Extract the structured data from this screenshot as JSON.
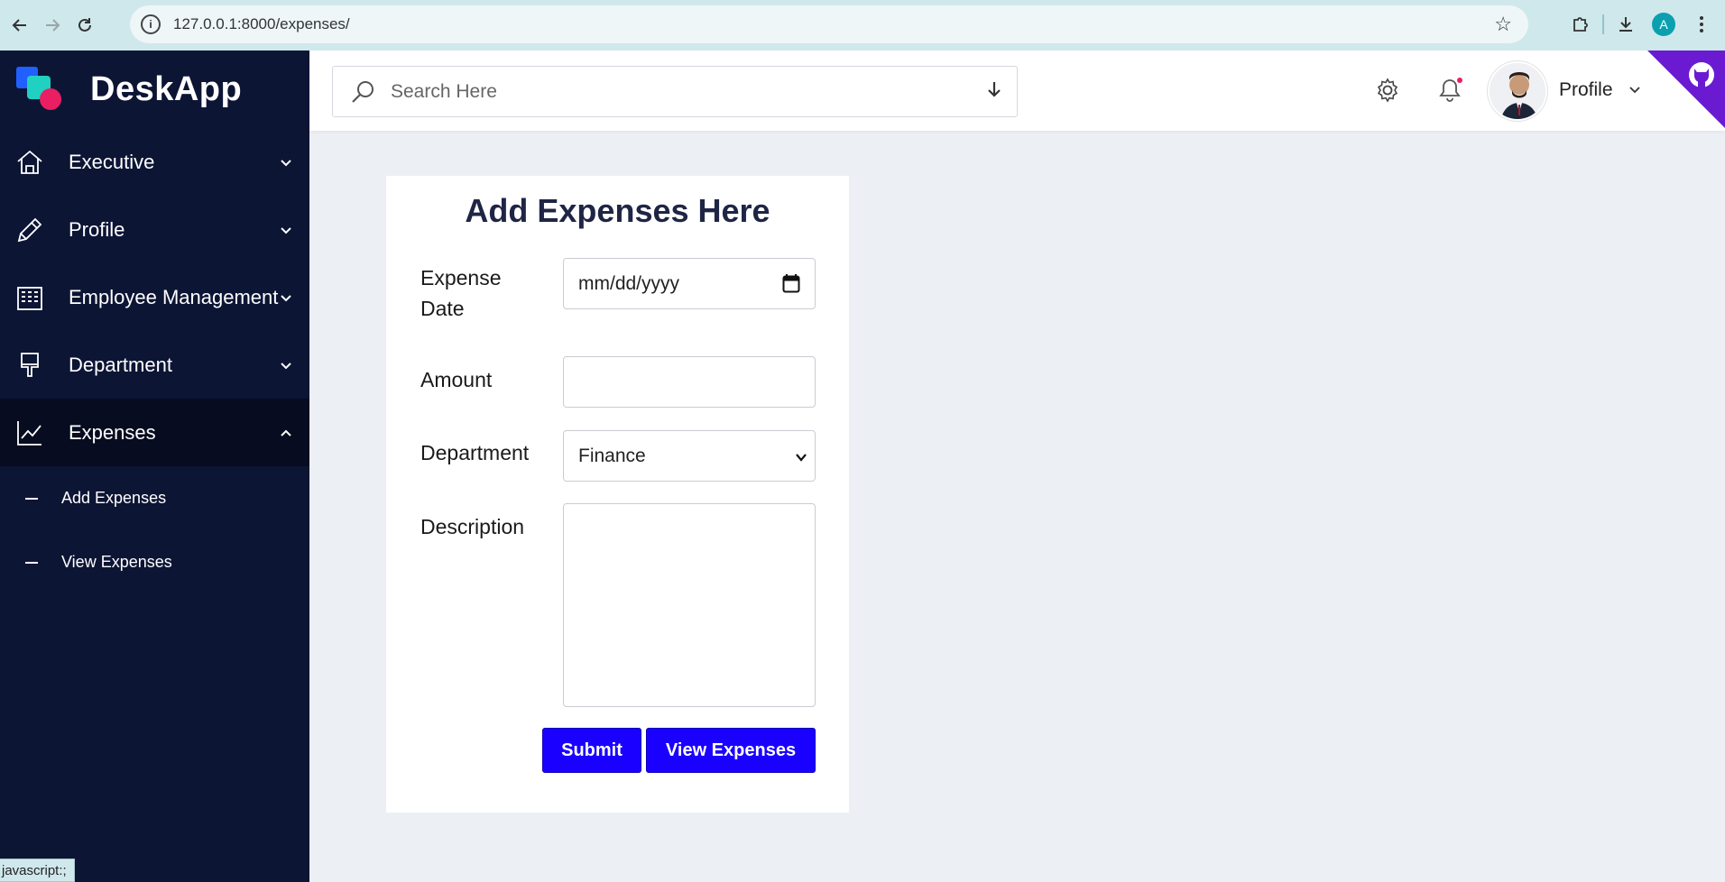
{
  "browser": {
    "url": "127.0.0.1:8000/expenses/",
    "profile_initial": "A",
    "status_text": "javascript:;"
  },
  "brand": {
    "name": "DeskApp"
  },
  "sidebar": {
    "items": [
      {
        "label": "Executive",
        "icon": "home-icon",
        "expanded": false
      },
      {
        "label": "Profile",
        "icon": "pencil-icon",
        "expanded": false
      },
      {
        "label": "Employee Management",
        "icon": "building-icon",
        "expanded": false
      },
      {
        "label": "Department",
        "icon": "paint-brush-icon",
        "expanded": false
      },
      {
        "label": "Expenses",
        "icon": "chart-line-icon",
        "expanded": true
      }
    ],
    "subitems": [
      {
        "label": "Add Expenses"
      },
      {
        "label": "View Expenses"
      }
    ]
  },
  "header": {
    "search_placeholder": "Search Here",
    "profile_label": "Profile"
  },
  "form": {
    "title": "Add Expenses Here",
    "expense_date_label": "Expense Date",
    "expense_date_placeholder": "mm/dd/yyyy",
    "amount_label": "Amount",
    "amount_value": "",
    "department_label": "Department",
    "department_selected": "Finance",
    "description_label": "Description",
    "description_value": "",
    "submit_label": "Submit",
    "view_label": "View Expenses"
  },
  "colors": {
    "sidebar_bg": "#0d1535",
    "button_bg": "#1a00ff",
    "title_color": "#1f2544",
    "github_corner": "#6a1bd1"
  }
}
